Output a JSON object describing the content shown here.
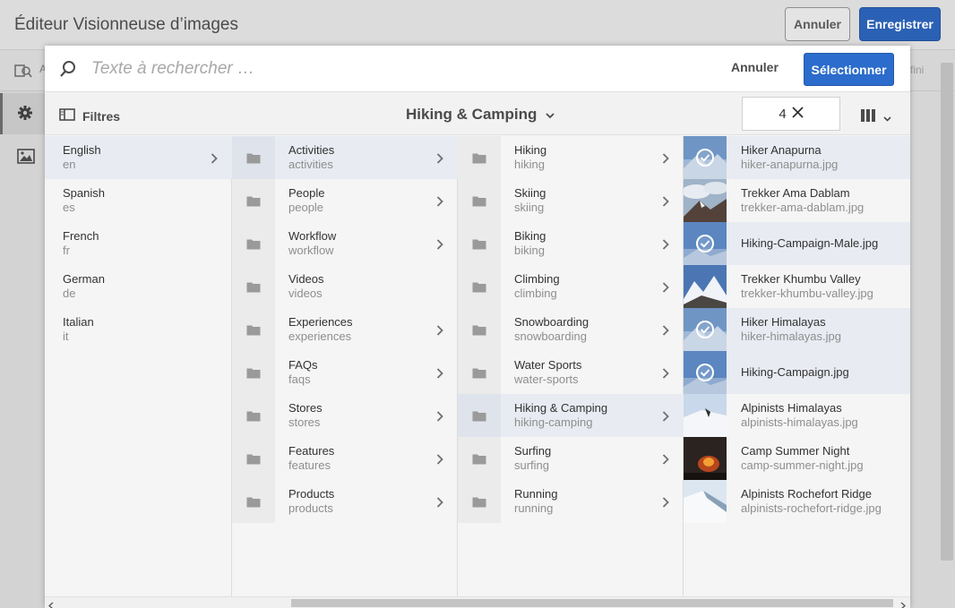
{
  "editor": {
    "title": "Éditeur Visionneuse d’images",
    "cancel_label": "Annuler",
    "save_label": "Enregistrer",
    "toolbar_text": "A",
    "toolbar_right_text": "fini"
  },
  "dialog": {
    "search_placeholder": "Texte à rechercher …",
    "cancel_label": "Annuler",
    "select_label": "Sélectionner",
    "filters_label": "Filtres",
    "breadcrumb": "Hiking & Camping",
    "selected_count": "4"
  },
  "columns": {
    "languages": [
      {
        "title": "English",
        "name": "en",
        "selected": true,
        "has_children": true
      },
      {
        "title": "Spanish",
        "name": "es"
      },
      {
        "title": "French",
        "name": "fr"
      },
      {
        "title": "German",
        "name": "de"
      },
      {
        "title": "Italian",
        "name": "it"
      }
    ],
    "sections": [
      {
        "title": "Activities",
        "name": "activities",
        "selected": true,
        "has_children": true
      },
      {
        "title": "People",
        "name": "people",
        "has_children": true
      },
      {
        "title": "Workflow",
        "name": "workflow",
        "has_children": true
      },
      {
        "title": "Videos",
        "name": "videos",
        "has_children": false
      },
      {
        "title": "Experiences",
        "name": "experiences",
        "has_children": true
      },
      {
        "title": "FAQs",
        "name": "faqs",
        "has_children": true
      },
      {
        "title": "Stores",
        "name": "stores",
        "has_children": true
      },
      {
        "title": "Features",
        "name": "features",
        "has_children": true
      },
      {
        "title": "Products",
        "name": "products",
        "has_children": true
      }
    ],
    "activities": [
      {
        "title": "Hiking",
        "name": "hiking",
        "has_children": true
      },
      {
        "title": "Skiing",
        "name": "skiing",
        "has_children": true
      },
      {
        "title": "Biking",
        "name": "biking",
        "has_children": true
      },
      {
        "title": "Climbing",
        "name": "climbing",
        "has_children": true
      },
      {
        "title": "Snowboarding",
        "name": "snowboarding",
        "has_children": true
      },
      {
        "title": "Water Sports",
        "name": "water-sports",
        "has_children": true
      },
      {
        "title": "Hiking & Camping",
        "name": "hiking-camping",
        "selected": true,
        "has_children": true
      },
      {
        "title": "Surfing",
        "name": "surfing",
        "has_children": true
      },
      {
        "title": "Running",
        "name": "running",
        "has_children": true
      }
    ],
    "assets": [
      {
        "title": "Hiker Anapurna",
        "name": "hiker-anapurna.jpg",
        "checked": true,
        "thumb": "sky-mountain"
      },
      {
        "title": "Trekker Ama Dablam",
        "name": "trekker-ama-dablam.jpg",
        "checked": false,
        "thumb": "clouds-peak"
      },
      {
        "title": "Hiking-Campaign-Male.jpg",
        "name": "",
        "checked": true,
        "thumb": "blue-sky"
      },
      {
        "title": "Trekker Khumbu Valley",
        "name": "trekker-khumbu-valley.jpg",
        "checked": false,
        "thumb": "valley"
      },
      {
        "title": "Hiker Himalayas",
        "name": "hiker-himalayas.jpg",
        "checked": true,
        "thumb": "sky-mountain"
      },
      {
        "title": "Hiking-Campaign.jpg",
        "name": "",
        "checked": true,
        "thumb": "blue-sky"
      },
      {
        "title": "Alpinists Himalayas",
        "name": "alpinists-himalayas.jpg",
        "checked": false,
        "thumb": "snow"
      },
      {
        "title": "Camp Summer Night",
        "name": "camp-summer-night.jpg",
        "checked": false,
        "thumb": "night-fire"
      },
      {
        "title": "Alpinists Rochefort Ridge",
        "name": "alpinists-rochefort-ridge.jpg",
        "checked": false,
        "thumb": "snow-ridge"
      }
    ]
  },
  "colors": {
    "primary": "#2b6ccc",
    "selected_row": "#e8ebf2",
    "folder_icon": "#9a9a9a"
  }
}
